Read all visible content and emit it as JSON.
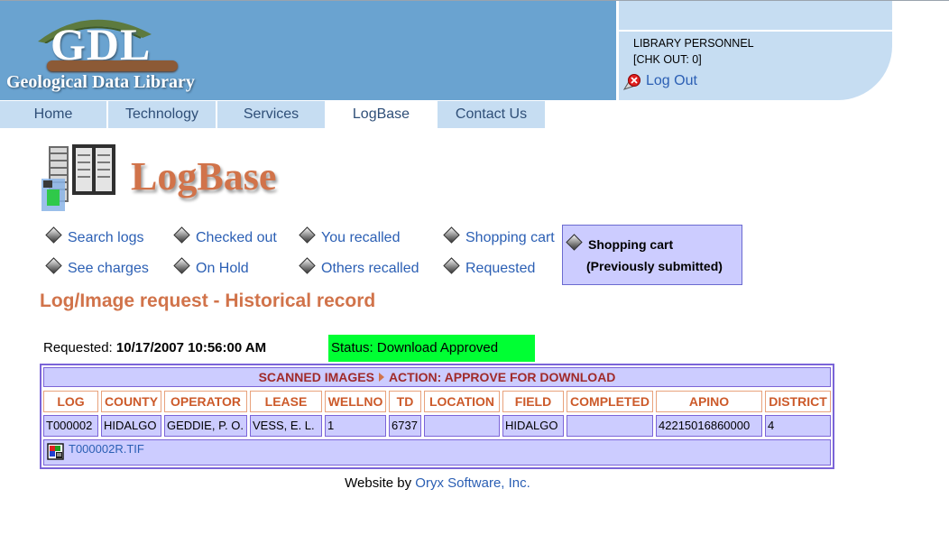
{
  "brand": {
    "logo_text": "GDL",
    "logo_subtitle": "Geological Data Library"
  },
  "user": {
    "role": "LIBRARY PERSONNEL",
    "checkout": "[CHK OUT: 0]",
    "logout_label": "Log Out"
  },
  "nav": {
    "tabs": [
      {
        "label": "Home"
      },
      {
        "label": "Technology"
      },
      {
        "label": "Services"
      },
      {
        "label": "LogBase"
      },
      {
        "label": "Contact Us"
      }
    ],
    "active_tab": "LogBase"
  },
  "page": {
    "title": "LogBase",
    "heading": "Log/Image request - Historical record"
  },
  "menu": {
    "row1": [
      "Search logs",
      "Checked out",
      "You recalled",
      "Shopping cart"
    ],
    "row2": [
      "See charges",
      "On Hold",
      "Others recalled",
      "Requested"
    ],
    "cart_box_line1": "Shopping cart",
    "cart_box_line2": "(Previously submitted)"
  },
  "request": {
    "label": "Requested:",
    "datetime": "10/17/2007 10:56:00 AM",
    "status": "Status: Download Approved"
  },
  "table": {
    "caption_left": "SCANNED IMAGES",
    "caption_right": "ACTION: APPROVE FOR DOWNLOAD",
    "headers": [
      "LOG",
      "COUNTY",
      "OPERATOR",
      "LEASE",
      "WELLNO",
      "TD",
      "LOCATION",
      "FIELD",
      "COMPLETED",
      "APINO",
      "DISTRICT"
    ],
    "row": [
      "T000002",
      "HIDALGO",
      "GEDDIE, P. O.",
      "VESS, E. L.",
      "1",
      "6737",
      "",
      "HIDALGO",
      "",
      "42215016860000",
      "4"
    ],
    "file": "T000002R.TIF"
  },
  "footer": {
    "prefix": "Website by",
    "company": "Oryx Software, Inc."
  },
  "colors": {
    "banner": "#6aa3d0",
    "tab_bg": "#c6ddf2",
    "accent_orange": "#d1734a",
    "table_fill": "#ccccff",
    "status_green": "#00ff33",
    "link_blue": "#2b5fb4"
  }
}
